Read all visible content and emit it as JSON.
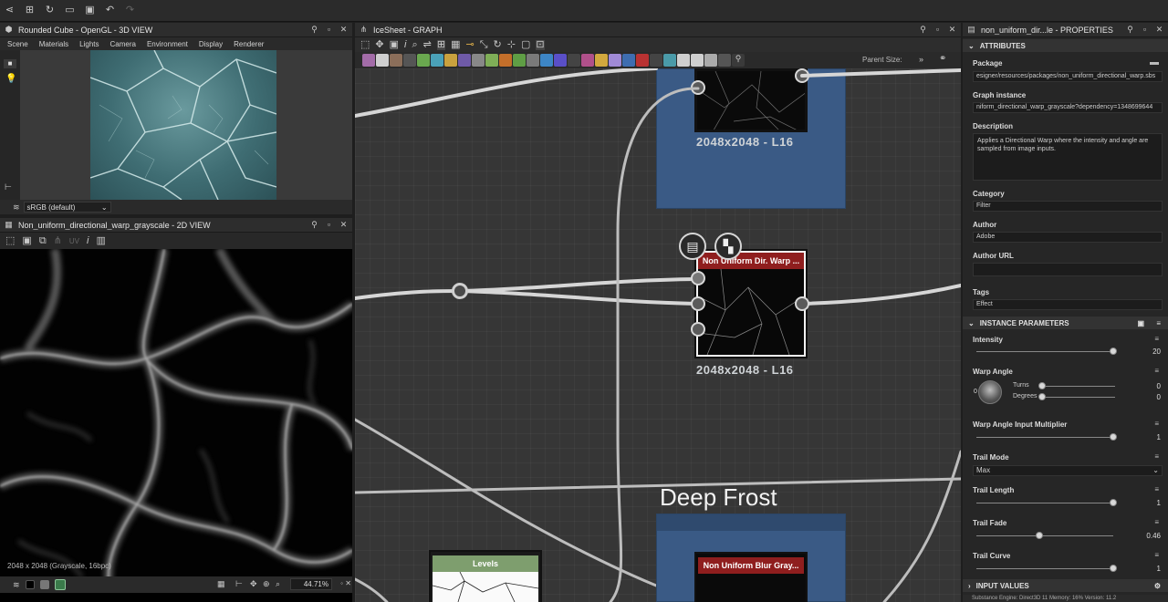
{
  "panels": {
    "view3d_title": "Rounded Cube - OpenGL - 3D VIEW",
    "view3d_menu": [
      "Scene",
      "Materials",
      "Lights",
      "Camera",
      "Environment",
      "Display",
      "Renderer"
    ],
    "colorspace": "sRGB (default)",
    "view2d_title": "Non_uniform_directional_warp_grayscale - 2D VIEW",
    "view2d_info": "2048 x 2048 (Grayscale, 16bpc)",
    "view2d_zoom": "44.71%",
    "view2d_uv": "UV",
    "graph_title": "IceSheet - GRAPH",
    "parent_size_label": "Parent Size:",
    "props_title": "non_uniform_dir...le - PROPERTIES"
  },
  "graph": {
    "top_node_res": "2048x2048 - L16",
    "main_node_title": "Non Uniform Dir. Warp ...",
    "main_node_res": "2048x2048 - L16",
    "frame_label": "Deep Frost",
    "levels_title": "Levels",
    "blur_node_title": "Non Uniform Blur Gray..."
  },
  "properties": {
    "attributes_header": "ATTRIBUTES",
    "package_label": "Package",
    "package_value": "esigner/resources/packages/non_uniform_directional_warp.sbs",
    "graph_instance_label": "Graph instance",
    "graph_instance_value": "niform_directional_warp_grayscale?dependency=1348699644",
    "description_label": "Description",
    "description_value": "Applies a Directional Warp where the intensity and angle are sampled from image inputs.",
    "category_label": "Category",
    "category_value": "Filter",
    "author_label": "Author",
    "author_value": "Adobe",
    "author_url_label": "Author URL",
    "author_url_value": "",
    "tags_label": "Tags",
    "tags_value": "Effect",
    "instance_header": "INSTANCE PARAMETERS",
    "intensity_label": "Intensity",
    "intensity_value": "20",
    "intensity_fraction": 1.0,
    "warp_angle_label": "Warp Angle",
    "warp_angle_knob": "0",
    "turns_label": "Turns",
    "turns_value": "0",
    "degrees_label": "Degrees",
    "degrees_value": "0",
    "multiplier_label": "Warp Angle Input Multiplier",
    "multiplier_value": "1",
    "multiplier_fraction": 1.0,
    "trail_mode_label": "Trail Mode",
    "trail_mode_value": "Max",
    "trail_length_label": "Trail Length",
    "trail_length_value": "1",
    "trail_length_fraction": 1.0,
    "trail_fade_label": "Trail Fade",
    "trail_fade_value": "0.46",
    "trail_fade_fraction": 0.46,
    "trail_curve_label": "Trail Curve",
    "trail_curve_value": "1",
    "trail_curve_fraction": 1.0,
    "input_values_header": "INPUT VALUES",
    "status_text": "Substance Engine: Direct3D 11 Memory: 16%     Version: 11.2"
  }
}
